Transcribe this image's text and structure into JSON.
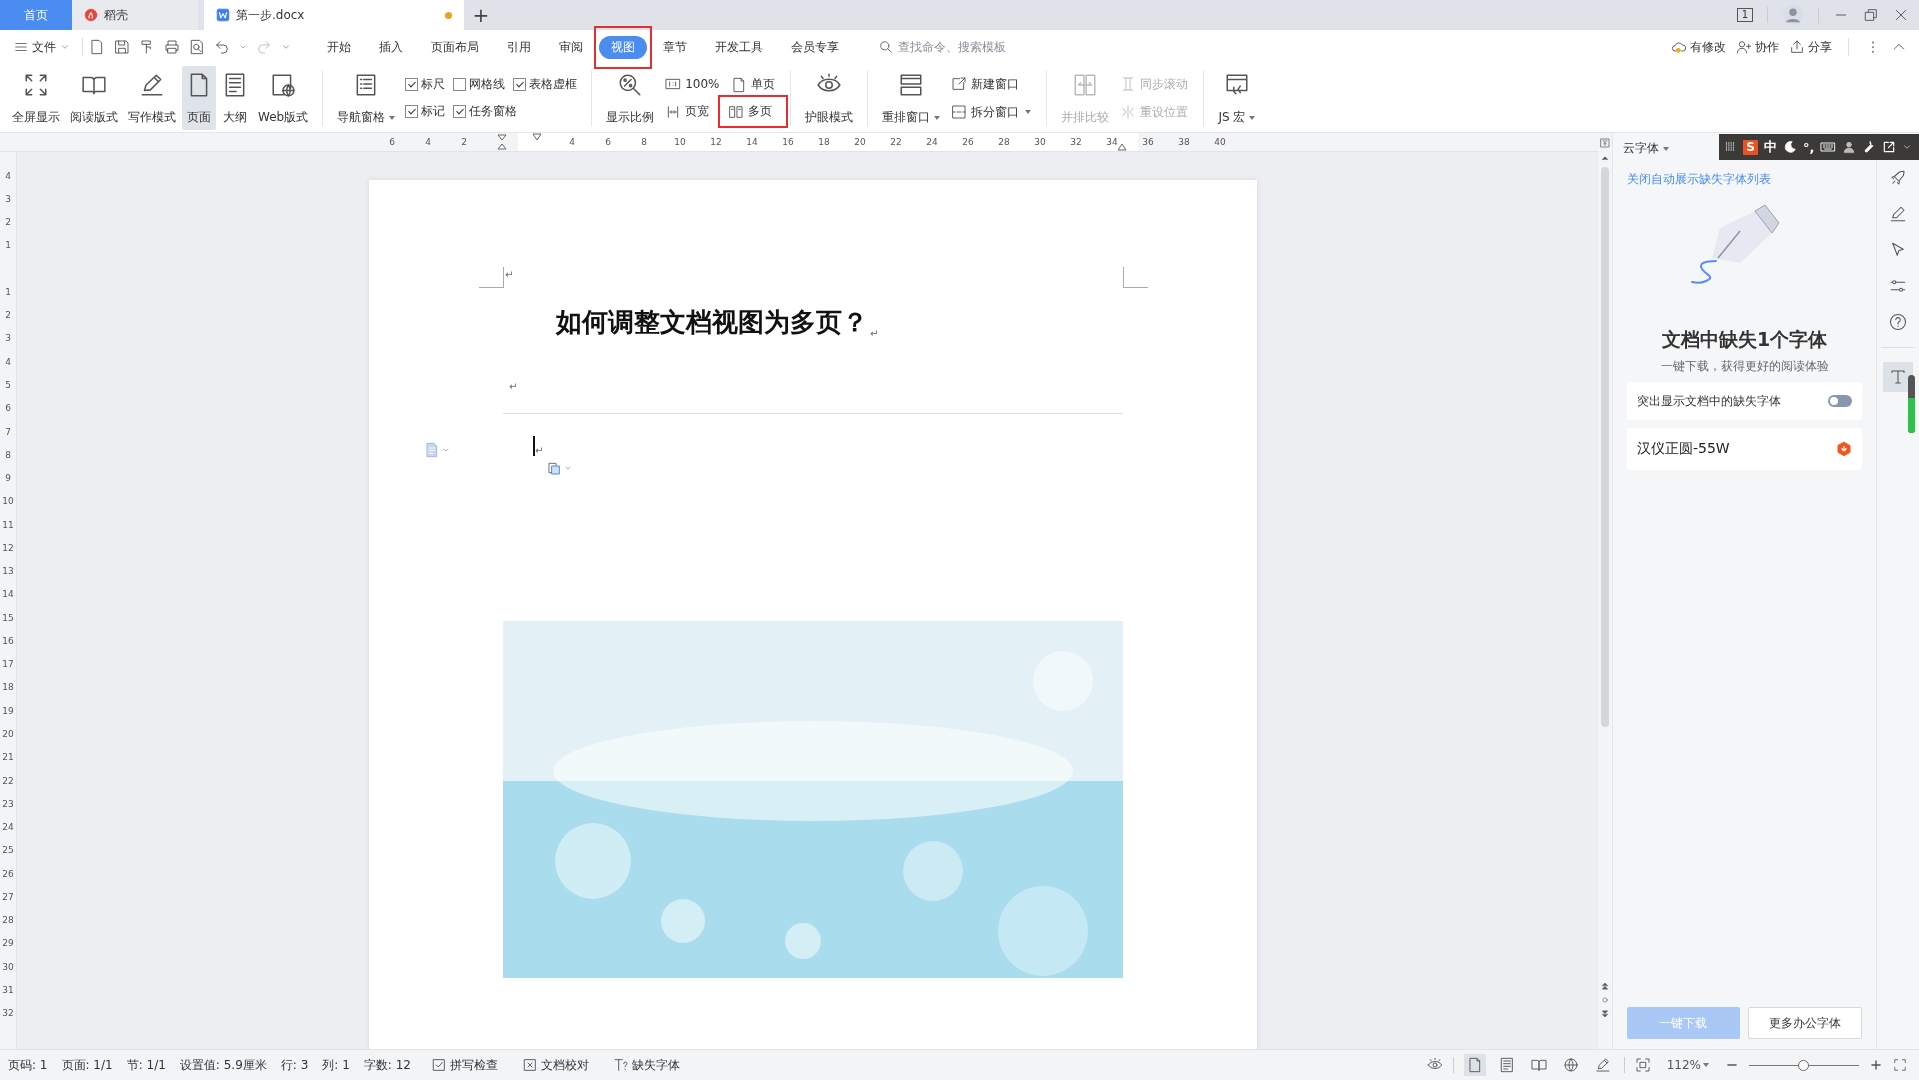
{
  "tabs": [
    {
      "label": "首页",
      "kind": "home",
      "selected": false,
      "modified": false
    },
    {
      "label": "稻壳",
      "kind": "docer",
      "selected": false,
      "modified": false
    },
    {
      "label": "第一步.docx",
      "kind": "document",
      "selected": true,
      "modified": true
    }
  ],
  "new_tab": "+",
  "window_badge": "1",
  "menu": {
    "file": "文件",
    "tabs": [
      {
        "label": "开始",
        "selected": false,
        "highlighted": false
      },
      {
        "label": "插入",
        "selected": false,
        "highlighted": false
      },
      {
        "label": "页面布局",
        "selected": false,
        "highlighted": false
      },
      {
        "label": "引用",
        "selected": false,
        "highlighted": false
      },
      {
        "label": "审阅",
        "selected": false,
        "highlighted": false
      },
      {
        "label": "视图",
        "selected": true,
        "highlighted": true
      },
      {
        "label": "章节",
        "selected": false,
        "highlighted": false
      },
      {
        "label": "开发工具",
        "selected": false,
        "highlighted": false
      },
      {
        "label": "会员专享",
        "selected": false,
        "highlighted": false
      }
    ],
    "search": {
      "placeholder": "查找命令、搜索模板"
    },
    "actions": [
      {
        "label": "有修改"
      },
      {
        "label": "协作"
      },
      {
        "label": "分享"
      }
    ]
  },
  "ribbon": {
    "groups": [
      {
        "items": [
          {
            "kind": "big",
            "label": "全屏显示",
            "selected": false,
            "disabled": false,
            "dropdown": false
          },
          {
            "kind": "big",
            "label": "阅读版式",
            "selected": false,
            "disabled": false,
            "dropdown": false
          },
          {
            "kind": "big",
            "label": "写作模式",
            "selected": false,
            "disabled": false,
            "dropdown": false
          },
          {
            "kind": "big",
            "label": "页面",
            "selected": true,
            "disabled": false,
            "dropdown": false
          },
          {
            "kind": "big",
            "label": "大纲",
            "selected": false,
            "disabled": false,
            "dropdown": false
          },
          {
            "kind": "big",
            "label": "Web版式",
            "selected": false,
            "disabled": false,
            "dropdown": false
          }
        ]
      },
      {
        "items": [
          {
            "kind": "big",
            "label": "导航窗格",
            "selected": false,
            "disabled": false,
            "dropdown": true
          },
          {
            "kind": "checks",
            "rows": [
              [
                {
                  "label": "标尺",
                  "checked": true
                },
                {
                  "label": "网格线",
                  "checked": false
                },
                {
                  "label": "表格虚框",
                  "checked": true
                }
              ],
              [
                {
                  "label": "标记",
                  "checked": true
                },
                {
                  "label": "任务窗格",
                  "checked": true
                }
              ]
            ]
          }
        ]
      },
      {
        "items": [
          {
            "kind": "big",
            "label": "显示比例",
            "selected": false,
            "disabled": false,
            "dropdown": false
          },
          {
            "kind": "stack",
            "rows": [
              {
                "label": "100%",
                "disabled": false,
                "dropdown": false,
                "highlighted": false
              },
              {
                "label": "页宽",
                "disabled": false,
                "dropdown": false,
                "highlighted": false
              }
            ]
          },
          {
            "kind": "stack",
            "rows": [
              {
                "label": "单页",
                "disabled": false,
                "dropdown": false,
                "highlighted": false
              },
              {
                "label": "多页",
                "disabled": false,
                "dropdown": false,
                "highlighted": true
              }
            ]
          }
        ]
      },
      {
        "items": [
          {
            "kind": "big",
            "label": "护眼模式",
            "selected": false,
            "disabled": false,
            "dropdown": false
          }
        ]
      },
      {
        "items": [
          {
            "kind": "big",
            "label": "重排窗口",
            "selected": false,
            "disabled": false,
            "dropdown": true
          },
          {
            "kind": "stack",
            "rows": [
              {
                "label": "新建窗口",
                "disabled": false,
                "dropdown": false,
                "highlighted": false
              },
              {
                "label": "拆分窗口",
                "disabled": false,
                "dropdown": true,
                "highlighted": false
              }
            ]
          }
        ]
      },
      {
        "items": [
          {
            "kind": "big",
            "label": "并排比较",
            "selected": false,
            "disabled": true,
            "dropdown": false
          },
          {
            "kind": "stack",
            "rows": [
              {
                "label": "同步滚动",
                "disabled": true,
                "dropdown": false,
                "highlighted": false
              },
              {
                "label": "重设位置",
                "disabled": true,
                "dropdown": false,
                "highlighted": false
              }
            ]
          }
        ]
      },
      {
        "items": [
          {
            "kind": "big",
            "label": "JS 宏",
            "selected": false,
            "disabled": false,
            "dropdown": true
          }
        ]
      }
    ]
  },
  "ruler": {
    "horizontal": {
      "before": [
        "6",
        "4",
        "2"
      ],
      "after": [
        "4",
        "6",
        "8",
        "10",
        "12",
        "14",
        "16",
        "18",
        "20",
        "22",
        "24",
        "26",
        "28",
        "30",
        "32",
        "34",
        "36",
        "38",
        "40"
      ]
    },
    "vertical": {
      "before": [
        "4",
        "3",
        "2",
        "1"
      ],
      "after": [
        "1",
        "2",
        "3",
        "4",
        "5",
        "6",
        "7",
        "8",
        "9",
        "10",
        "11",
        "12",
        "13",
        "14",
        "15",
        "16",
        "17",
        "18",
        "19",
        "20",
        "21",
        "22",
        "23",
        "24",
        "25",
        "26",
        "27",
        "28",
        "29",
        "30",
        "31",
        "32"
      ]
    }
  },
  "document": {
    "blocks": [
      {
        "kind": "mark",
        "text": "↵"
      },
      {
        "kind": "heading",
        "text": "如何调整文档视图为多页？",
        "mark": "↵"
      },
      {
        "kind": "mark",
        "text": "↵"
      },
      {
        "kind": "rule"
      },
      {
        "kind": "cursor",
        "text": "↵"
      },
      {
        "kind": "picture"
      }
    ]
  },
  "panel": {
    "title": "云字体",
    "link": "关闭自动展示缺失字体列表",
    "heading": "文档中缺失1个字体",
    "subheading": "一键下载，获得更好的阅读体验",
    "toggle": {
      "label": "突出显示文档中的缺失字体",
      "on": false
    },
    "fonts": [
      {
        "name": "汉仪正圆-55W"
      }
    ],
    "buttons": [
      {
        "label": "一键下载",
        "kind": "primary",
        "disabled": true
      },
      {
        "label": "更多办公字体",
        "kind": "secondary",
        "disabled": false
      }
    ]
  },
  "side_tools": [
    {
      "selected": false
    },
    {
      "selected": false
    },
    {
      "selected": false
    },
    {
      "selected": false
    },
    {
      "selected": false
    },
    {
      "selected": true
    }
  ],
  "ime": {
    "logo": "S",
    "mode": "中",
    "punctuation": "°,"
  },
  "meter": {
    "level": 0.6
  },
  "status_bar": {
    "items": [
      "页码: 1",
      "页面: 1/1",
      "节: 1/1",
      "设置值: 5.9厘米",
      "行: 3",
      "列: 1",
      "字数: 12"
    ],
    "tools": [
      {
        "label": "拼写检查"
      },
      {
        "label": "文档校对"
      },
      {
        "label": "缺失字体"
      }
    ],
    "views": [
      {
        "selected": true
      },
      {
        "selected": false
      },
      {
        "selected": false
      },
      {
        "selected": false
      },
      {
        "selected": false
      }
    ],
    "zoom": {
      "value": "112%",
      "level": 0.5
    }
  }
}
